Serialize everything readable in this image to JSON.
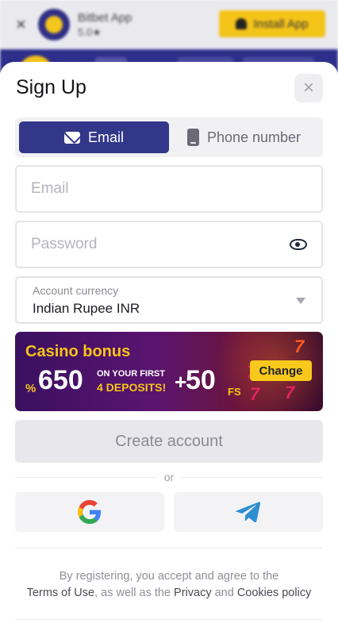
{
  "banner": {
    "close_glyph": "×",
    "app_name": "Bitbet App",
    "rating": "5.0★",
    "install_label": "Install App",
    "install_icon": "android-icon",
    "accent": "#f5c419"
  },
  "sheet": {
    "title": "Sign Up",
    "close_glyph": "×"
  },
  "tabs": [
    {
      "label": "Email",
      "icon": "mail-icon",
      "active": true
    },
    {
      "label": "Phone number",
      "icon": "phone-icon",
      "active": false
    }
  ],
  "form": {
    "email_placeholder": "Email",
    "password_placeholder": "Password",
    "currency_label": "Account currency",
    "currency_value": "Indian Rupee INR"
  },
  "promo": {
    "title": "Casino bonus",
    "percent_sign": "%",
    "percent_value": "650",
    "line1": "ON YOUR FIRST",
    "line2": "4 DEPOSITS!",
    "plus": "+",
    "fs_value": "50",
    "fs_suffix": "FS",
    "change_label": "Change"
  },
  "actions": {
    "create_label": "Create account",
    "or_label": "or",
    "google_icon": "google-icon",
    "telegram_icon": "telegram-icon"
  },
  "legal": {
    "line1": "By registering, you accept and agree to the",
    "terms": "Terms of Use",
    "sep1": ", as well as the ",
    "privacy": "Privacy",
    "and": " and ",
    "cookies": "Cookies policy"
  },
  "colors": {
    "primary": "#33378a",
    "accent": "#f7c518",
    "muted": "#8e8e9a"
  }
}
